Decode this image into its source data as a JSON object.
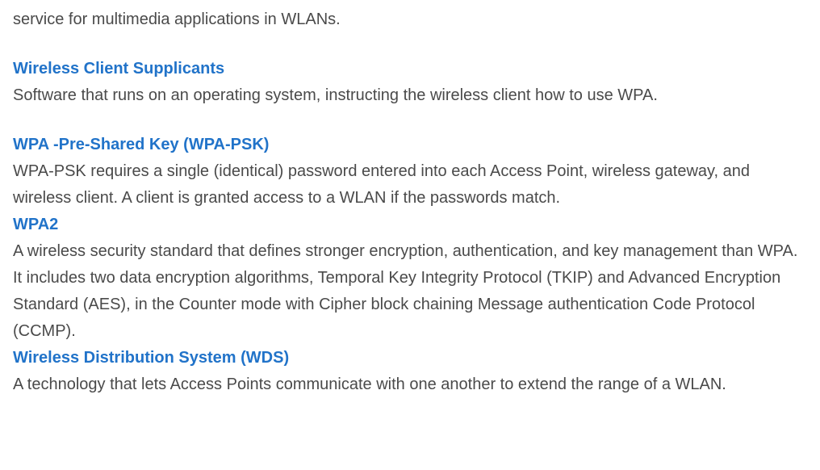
{
  "entries": {
    "partial_top": {
      "text": "service for multimedia applications in WLANs."
    },
    "wireless_client_supplicants": {
      "heading": "Wireless Client Supplicants",
      "definition": "Software that runs on an operating system, instructing the wireless client how to use WPA."
    },
    "wpa_psk": {
      "heading": "WPA -Pre-Shared Key (WPA-PSK)",
      "definition": "WPA-PSK requires a single (identical) password entered into each Access Point, wireless gateway, and wireless client. A client is granted access to a WLAN if the passwords match."
    },
    "wpa2": {
      "heading": "WPA2",
      "definition": "A wireless security standard that defines stronger encryption, authentication, and key management than WPA. It includes two data encryption algorithms, Temporal Key Integrity Protocol (TKIP) and Advanced Encryption Standard (AES), in the Counter mode with Cipher block chaining Message authentication Code Protocol (CCMP)."
    },
    "wds": {
      "heading": "Wireless Distribution System (WDS)",
      "definition": "A technology that lets Access Points communicate with one another to extend the range of a WLAN."
    }
  }
}
